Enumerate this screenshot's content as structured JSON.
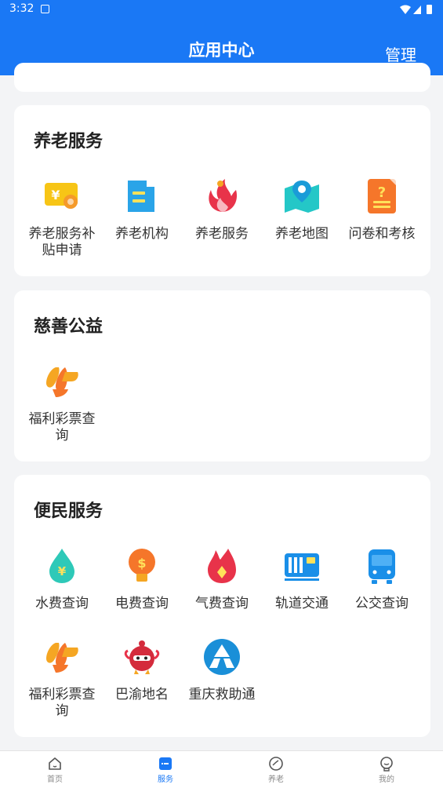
{
  "status_bar": {
    "time": "3:32"
  },
  "header": {
    "title": "应用中心",
    "manage": "管理"
  },
  "sections": [
    {
      "title": "养老服务",
      "items": [
        {
          "icon": "subsidy-ticket-icon",
          "label": "养老服务补贴申请"
        },
        {
          "icon": "institution-icon",
          "label": "养老机构"
        },
        {
          "icon": "elderly-service-icon",
          "label": "养老服务"
        },
        {
          "icon": "elderly-map-icon",
          "label": "养老地图"
        },
        {
          "icon": "questionnaire-icon",
          "label": "问卷和考核"
        }
      ]
    },
    {
      "title": "慈善公益",
      "items": [
        {
          "icon": "welfare-lottery-icon",
          "label": "福利彩票查询"
        }
      ]
    },
    {
      "title": "便民服务",
      "items": [
        {
          "icon": "water-fee-icon",
          "label": "水费查询"
        },
        {
          "icon": "electricity-fee-icon",
          "label": "电费查询"
        },
        {
          "icon": "gas-fee-icon",
          "label": "气费查询"
        },
        {
          "icon": "rail-transit-icon",
          "label": "轨道交通"
        },
        {
          "icon": "bus-icon",
          "label": "公交查询"
        },
        {
          "icon": "welfare-lottery-icon",
          "label": "福利彩票查询"
        },
        {
          "icon": "bayu-place-name-icon",
          "label": "巴渝地名"
        },
        {
          "icon": "chongqing-rescue-icon",
          "label": "重庆救助通"
        }
      ]
    }
  ],
  "tabbar": [
    {
      "icon": "home-icon",
      "label": "首页",
      "active": false
    },
    {
      "icon": "service-icon",
      "label": "服务",
      "active": true
    },
    {
      "icon": "elderly-icon",
      "label": "养老",
      "active": false
    },
    {
      "icon": "profile-icon",
      "label": "我的",
      "active": false
    }
  ],
  "colors": {
    "primary": "#1a78f5",
    "background": "#f3f4f6"
  }
}
